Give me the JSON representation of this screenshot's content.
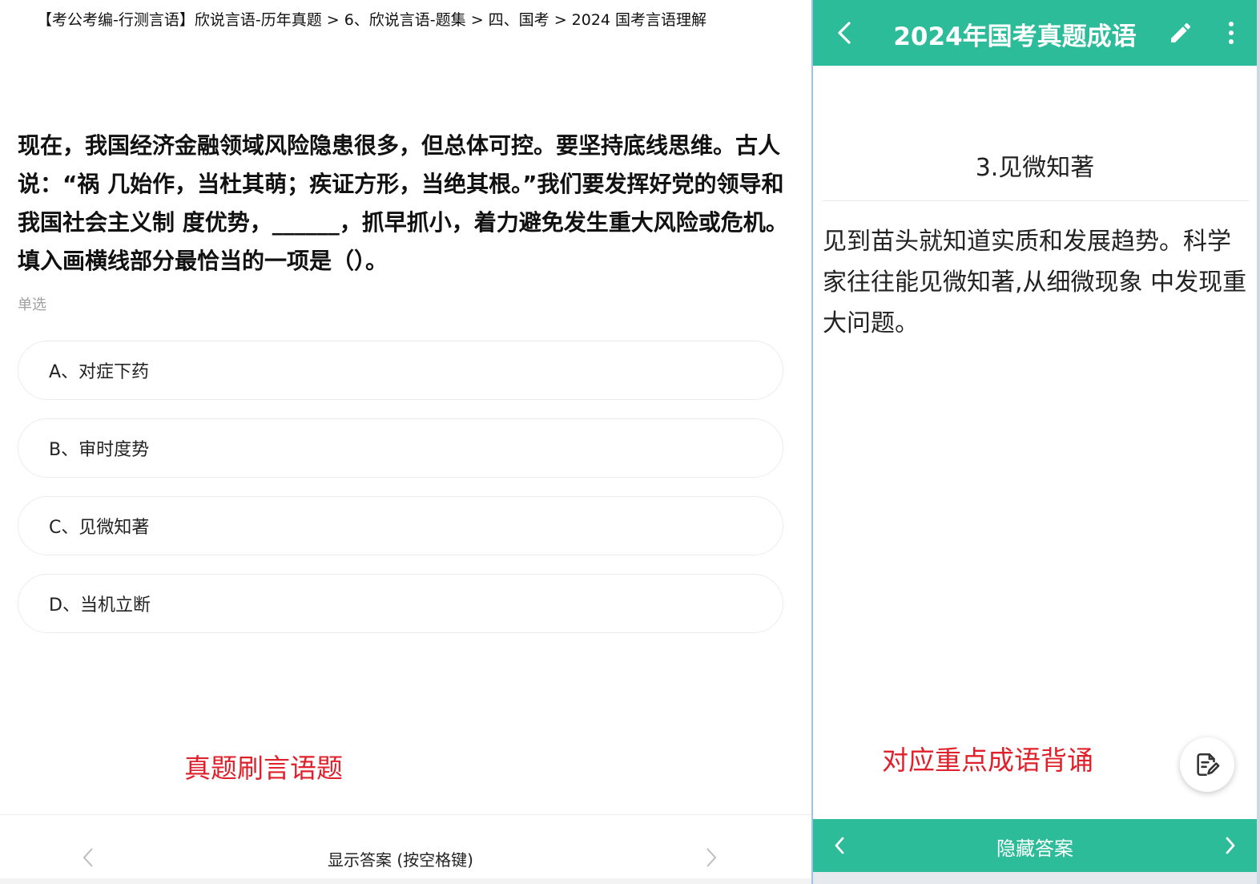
{
  "left": {
    "breadcrumb": "【考公考编-行测言语】欣说言语-历年真题 > 6、欣说言语-题集 > 四、国考 > 2024 国考言语理解",
    "question": "现在，我国经济金融领域风险隐患很多，但总体可控。要坚持底线思维。古人说：“祸 几始作，当杜其萌；疾证方形，当绝其根。”我们要发挥好党的领导和我国社会主义制 度优势，______，抓早抓小，着力避免发生重大风险或危机。 填入画横线部分最恰当的一项是（）。",
    "question_type": "单选",
    "options": [
      {
        "label": "A、对症下药"
      },
      {
        "label": "B、审时度势"
      },
      {
        "label": "C、见微知著"
      },
      {
        "label": "D、当机立断"
      }
    ],
    "annotation": "真题刷言语题",
    "footer": {
      "prev_icon": "chevron-left-icon",
      "show_answer": "显示答案 (按空格键)",
      "next_icon": "chevron-right-icon"
    }
  },
  "right": {
    "header": {
      "title": "2024年国考真题成语",
      "back_icon": "back-arrow-icon",
      "edit_icon": "pencil-icon",
      "more_icon": "more-vertical-icon"
    },
    "idiom_title": "3.见微知著",
    "idiom_definition": "见到苗头就知道实质和发展趋势。科学家往往能见微知著,从细微现象 中发现重大问题。",
    "annotation": "对应重点成语背诵",
    "fab_icon": "note-edit-icon",
    "footer": {
      "prev_icon": "chevron-left-icon",
      "hide_answer": "隐藏答案",
      "next_icon": "chevron-right-icon"
    }
  },
  "colors": {
    "accent": "#2dbc9a",
    "annotation_red": "#e0202a",
    "muted_text": "#a0a0a0"
  }
}
